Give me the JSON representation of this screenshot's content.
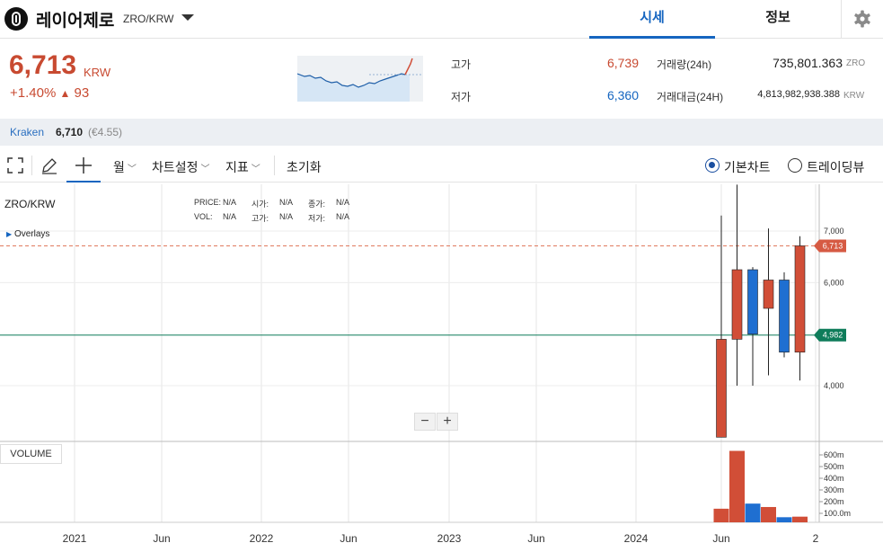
{
  "header": {
    "coin_name": "레이어제로",
    "pair": "ZRO/KRW",
    "tabs": [
      {
        "label": "시세",
        "active": true
      },
      {
        "label": "정보",
        "active": false
      }
    ]
  },
  "ticker": {
    "price": "6,713",
    "currency": "KRW",
    "change_percent": "+1.40%",
    "change_arrow": "▲",
    "change_amount": "93",
    "high_label": "고가",
    "high_value": "6,739",
    "low_label": "저가",
    "low_value": "6,360",
    "volume_label": "거래량(24h)",
    "volume_value": "735,801.363",
    "volume_unit": "ZRO",
    "amount_label": "거래대금(24H)",
    "amount_value": "4,813,982,938.388",
    "amount_unit": "KRW"
  },
  "exchange": {
    "name": "Kraken",
    "price": "6,710",
    "euro": "(€4.55)"
  },
  "toolbar": {
    "period_label": "월",
    "chart_settings_label": "차트설정",
    "indicator_label": "지표",
    "reset_label": "초기화",
    "basic_chart_label": "기본차트",
    "tradingview_label": "트레이딩뷰",
    "basic_selected": true
  },
  "chart": {
    "symbol": "ZRO/KRW",
    "overlays_label": "Overlays",
    "info": {
      "price_label": "PRICE:",
      "price_value": "N/A",
      "open_label": "시가:",
      "open_value": "N/A",
      "close_label": "종가:",
      "close_value": "N/A",
      "vol_label": "VOL:",
      "vol_value": "N/A",
      "high_label": "고가:",
      "high_value": "N/A",
      "low_label": "저가:",
      "low_value": "N/A"
    },
    "volume_tag": "VOLUME",
    "zoom_out": "−",
    "zoom_in": "+",
    "current_price_tag": "6,713",
    "level_tag": "4,982",
    "colors": {
      "up": "#d14e37",
      "down": "#1f6fd1",
      "current_line": "#e07a5f",
      "level_line": "#0e7c5a"
    }
  },
  "chart_data": {
    "type": "candlestick",
    "x_ticks": [
      "2021",
      "Jun",
      "2022",
      "Jun",
      "2023",
      "Jun",
      "2024",
      "Jun",
      "2"
    ],
    "y_ticks": [
      "7,000",
      "6,000",
      "4,000"
    ],
    "volume_ticks": [
      "600m",
      "500m",
      "400m",
      "300m",
      "200m",
      "100.0m"
    ],
    "candles": [
      {
        "open": 3000,
        "close": 4900,
        "high": 7300,
        "low": 3000,
        "direction": "up",
        "volume": 120
      },
      {
        "open": 4900,
        "close": 6250,
        "high": 7900,
        "low": 4000,
        "direction": "up",
        "volume": 630
      },
      {
        "open": 6250,
        "close": 5000,
        "high": 6300,
        "low": 4000,
        "direction": "down",
        "volume": 165
      },
      {
        "open": 5500,
        "close": 6050,
        "high": 7050,
        "low": 4200,
        "direction": "up",
        "volume": 135
      },
      {
        "open": 6050,
        "close": 4650,
        "high": 6200,
        "low": 4550,
        "direction": "down",
        "volume": 45
      },
      {
        "open": 4650,
        "close": 6713,
        "high": 6900,
        "low": 4100,
        "direction": "up",
        "volume": 50
      }
    ],
    "current_price": 6713,
    "level_line": 4982,
    "ylim": [
      3000,
      7900
    ],
    "volume_max": 650
  }
}
